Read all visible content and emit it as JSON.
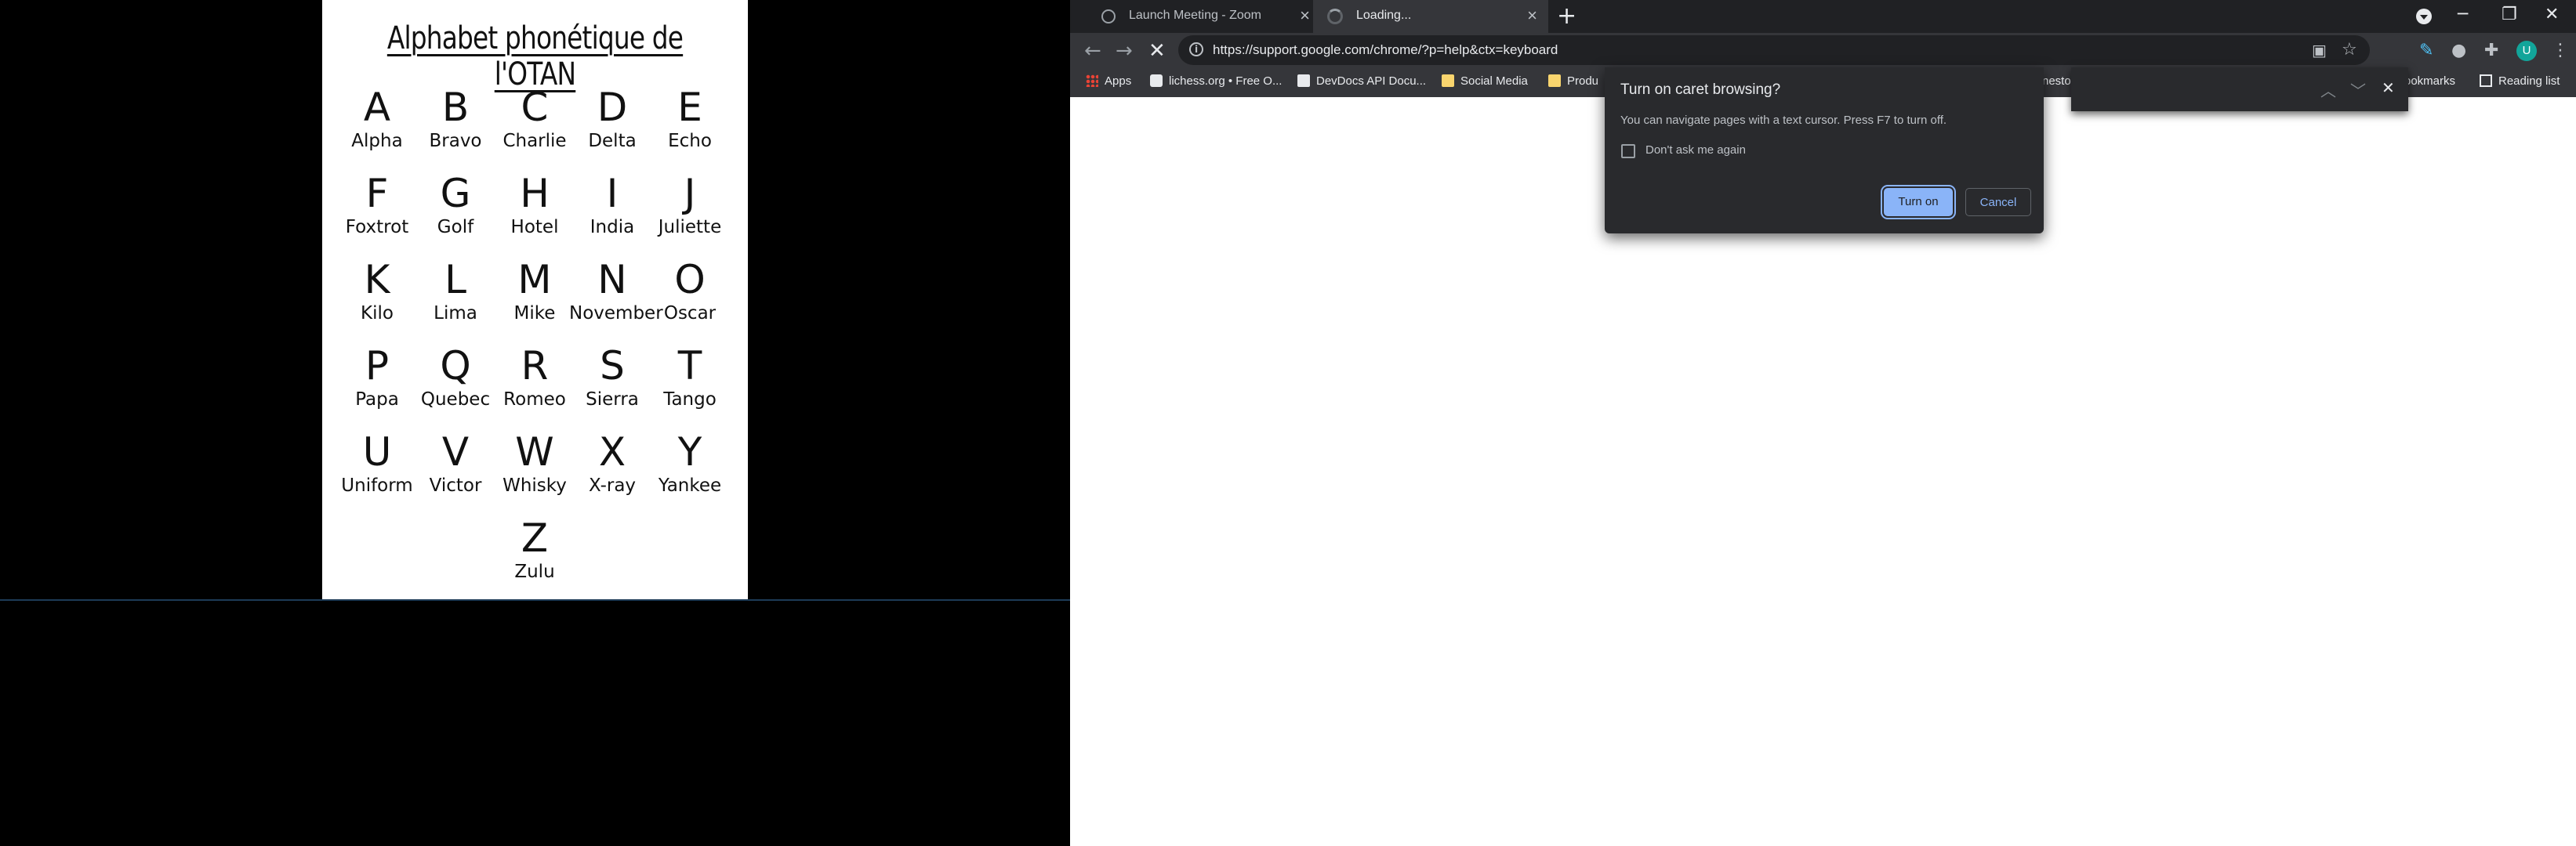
{
  "poster": {
    "title": "Alphabet phonétique de l'OTAN",
    "rows": [
      [
        {
          "l": "A",
          "w": "Alpha"
        },
        {
          "l": "B",
          "w": "Bravo"
        },
        {
          "l": "C",
          "w": "Charlie"
        },
        {
          "l": "D",
          "w": "Delta"
        },
        {
          "l": "E",
          "w": "Echo"
        }
      ],
      [
        {
          "l": "F",
          "w": "Foxtrot"
        },
        {
          "l": "G",
          "w": "Golf"
        },
        {
          "l": "H",
          "w": "Hotel"
        },
        {
          "l": "I",
          "w": "India"
        },
        {
          "l": "J",
          "w": "Juliette"
        }
      ],
      [
        {
          "l": "K",
          "w": "Kilo"
        },
        {
          "l": "L",
          "w": "Lima"
        },
        {
          "l": "M",
          "w": "Mike"
        },
        {
          "l": "N",
          "w": "November"
        },
        {
          "l": "O",
          "w": "Oscar"
        }
      ],
      [
        {
          "l": "P",
          "w": "Papa"
        },
        {
          "l": "Q",
          "w": "Quebec"
        },
        {
          "l": "R",
          "w": "Romeo"
        },
        {
          "l": "S",
          "w": "Sierra"
        },
        {
          "l": "T",
          "w": "Tango"
        }
      ],
      [
        {
          "l": "U",
          "w": "Uniform"
        },
        {
          "l": "V",
          "w": "Victor"
        },
        {
          "l": "W",
          "w": "Whisky"
        },
        {
          "l": "X",
          "w": "X-ray"
        },
        {
          "l": "Y",
          "w": "Yankee"
        }
      ],
      [
        {
          "l": "Z",
          "w": "Zulu"
        }
      ]
    ]
  },
  "browser": {
    "tabs": [
      {
        "title": "Launch Meeting - Zoom",
        "icon": "globe-icon"
      },
      {
        "title": "Loading...",
        "icon": "spinner-icon"
      }
    ],
    "new_tab": "+",
    "window_buttons": {
      "minimize": "─",
      "restore": "❐",
      "close": "✕"
    },
    "url": "https://support.google.com/chrome/?p=help&ctx=keyboard",
    "bookmarks": [
      {
        "label": "Apps",
        "icon": "apps-grid-icon"
      },
      {
        "label": "lichess.org • Free O...",
        "icon": "lichess-icon"
      },
      {
        "label": "DevDocs API Docu...",
        "icon": "devdocs-icon"
      },
      {
        "label": "Social Media",
        "icon": "folder-icon"
      },
      {
        "label": "Produ",
        "icon": "folder-icon"
      },
      {
        "label": "nesto",
        "icon": ""
      },
      {
        "label": "ookmarks",
        "icon": ""
      },
      {
        "label": "Reading list",
        "icon": "reading-list-icon"
      }
    ],
    "profile_initial": "U"
  },
  "dialog": {
    "title": "Turn on caret browsing?",
    "message": "You can navigate pages with a text cursor. Press F7 to turn off.",
    "checkbox_label": "Don't ask me again",
    "primary_label": "Turn on",
    "secondary_label": "Cancel"
  },
  "colors": {
    "accent": "#8ab4f8",
    "tabstrip": "#202124",
    "toolbar": "#35363a",
    "avatar": "#12a59a"
  }
}
